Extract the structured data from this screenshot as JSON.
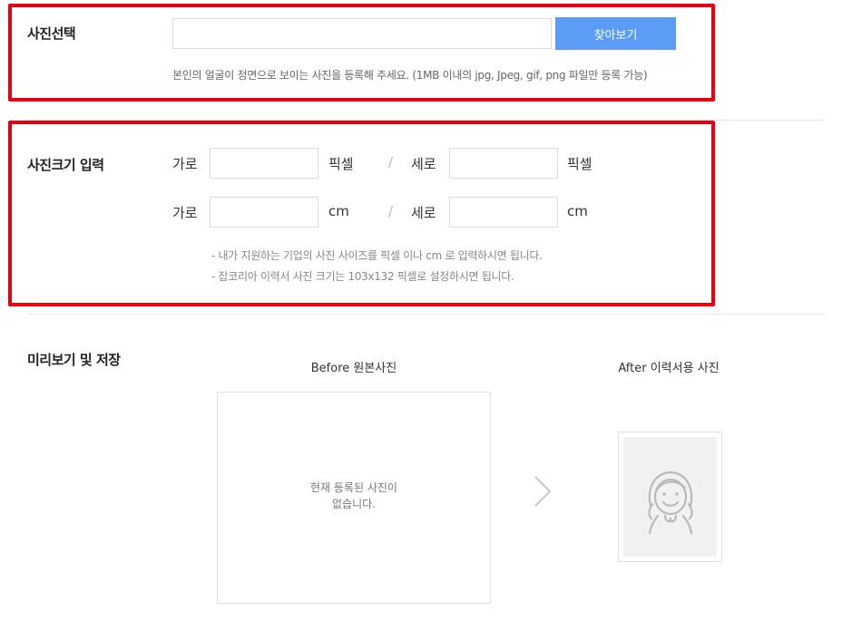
{
  "photo_select": {
    "title": "사진선택",
    "input_value": "",
    "find_button": "찾아보기",
    "note": "본인의 얼굴이 정면으로 보이는 사진을 등록해 주세요. (1MB 이내의 jpg, Jpeg, gif, png 파일만 등록 가능)"
  },
  "size_input": {
    "title": "사진크기 입력",
    "row_px": {
      "width_label": "가로",
      "height_label": "세로",
      "unit": "픽셀",
      "width_value": "",
      "height_value": ""
    },
    "row_cm": {
      "width_label": "가로",
      "height_label": "세로",
      "unit": "cm",
      "width_value": "",
      "height_value": ""
    },
    "separator": "/",
    "notes": [
      "- 내가 지원하는 기업의 사진 사이즈를 픽셀 이나 cm 로 입력하시면 됩니다.",
      "- 잡코리아 이력서 사진 크기는 103x132 픽셀로 설정하시면 됩니다."
    ]
  },
  "preview": {
    "title": "미리보기 및 저장",
    "before_caption": "Before 원본사진",
    "after_caption": "After 이력서용 사진",
    "empty_message_line1": "현재 등록된 사진이",
    "empty_message_line2": "없습니다.",
    "arrow_icon": "chevron-right-icon",
    "placeholder_icon": "person-placeholder-icon"
  },
  "colors": {
    "highlight": "#e60012",
    "button": "#5b9cf7"
  }
}
